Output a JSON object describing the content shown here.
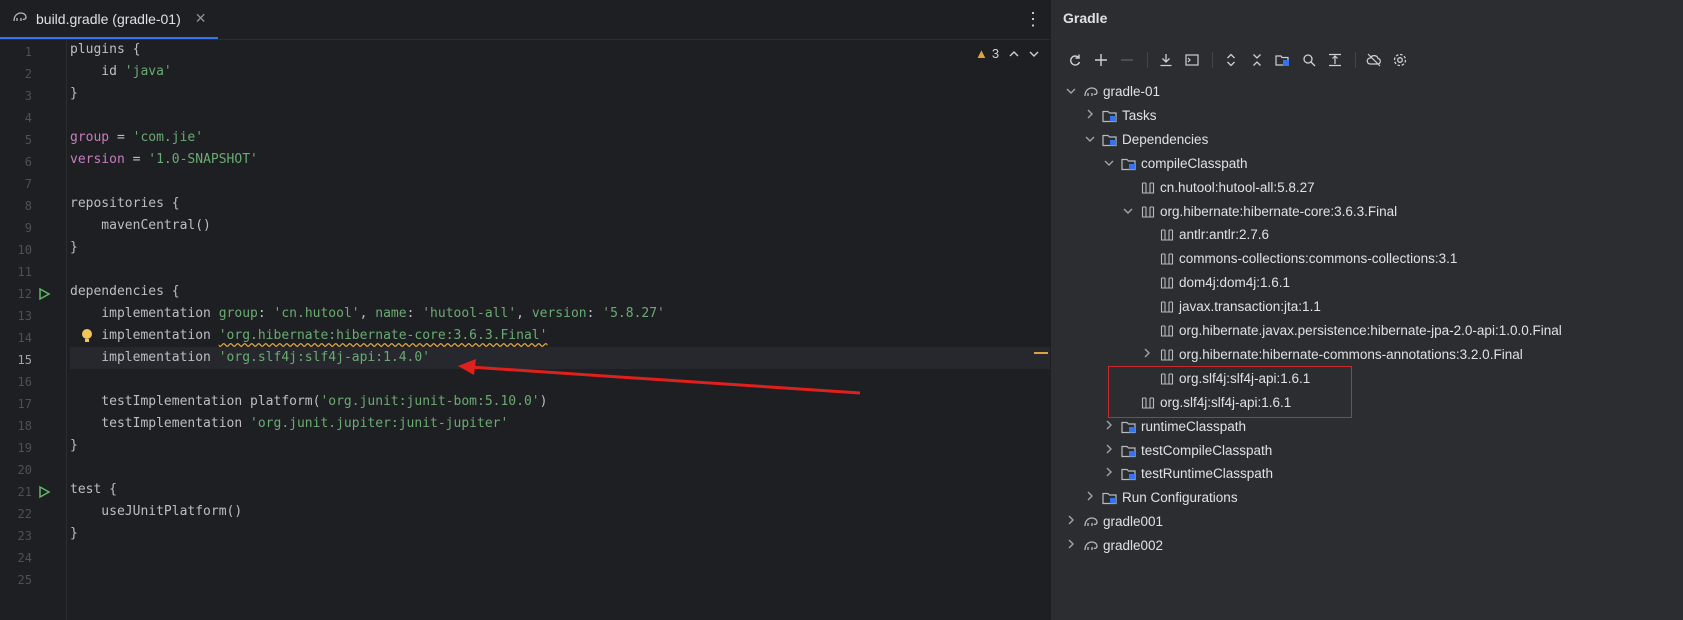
{
  "editor": {
    "tab": {
      "title": "build.gradle (gradle-01)",
      "close": "✕"
    },
    "menu_glyph": "⋮",
    "inspections": {
      "warning_count": "3",
      "up": "^",
      "down": "v"
    },
    "lines": [
      {
        "n": "1"
      },
      {
        "n": "2"
      },
      {
        "n": "3"
      },
      {
        "n": "4"
      },
      {
        "n": "5"
      },
      {
        "n": "6"
      },
      {
        "n": "7"
      },
      {
        "n": "8"
      },
      {
        "n": "9"
      },
      {
        "n": "10"
      },
      {
        "n": "11"
      },
      {
        "n": "12"
      },
      {
        "n": "13"
      },
      {
        "n": "14"
      },
      {
        "n": "15"
      },
      {
        "n": "16"
      },
      {
        "n": "17"
      },
      {
        "n": "18"
      },
      {
        "n": "19"
      },
      {
        "n": "20"
      },
      {
        "n": "21"
      },
      {
        "n": "22"
      },
      {
        "n": "23"
      },
      {
        "n": "24"
      },
      {
        "n": "25"
      }
    ],
    "code": {
      "l1": "plugins {",
      "l2a": "    id ",
      "l2b": "'java'",
      "l3": "}",
      "l5a": "group",
      "l5b": " = ",
      "l5c": "'com.jie'",
      "l6a": "version",
      "l6b": " = ",
      "l6c": "'1.0-SNAPSHOT'",
      "l8": "repositories {",
      "l9": "    mavenCentral()",
      "l10": "}",
      "l12": "dependencies {",
      "l13a": "    implementation ",
      "l13b": "group",
      "l13c": ": ",
      "l13d": "'cn.hutool'",
      "l13e": ", ",
      "l13f": "name",
      "l13g": ": ",
      "l13h": "'hutool-all'",
      "l13i": ", ",
      "l13j": "version",
      "l13k": ": ",
      "l13l": "'5.8.27'",
      "l14a": "    implementation ",
      "l14b": "'org.hibernate:hibernate-core:3.6.3.Final'",
      "l15a": "    implementation ",
      "l15b": "'org.slf4j:slf4j-api:1.4.0'",
      "l17a": "    testImplementation platform(",
      "l17b": "'org.junit:junit-bom:5.10.0'",
      "l17c": ")",
      "l18a": "    testImplementation ",
      "l18b": "'org.junit.jupiter:junit-jupiter'",
      "l19": "}",
      "l21": "test {",
      "l22": "    useJUnitPlatform()",
      "l23": "}"
    }
  },
  "gradle": {
    "title": "Gradle",
    "toolbar": [
      "refresh-icon",
      "add-icon",
      "remove-icon",
      "download-icon",
      "execute-task-icon",
      "expand-all-icon",
      "collapse-all-icon",
      "group-modules-icon",
      "analyze-icon",
      "show-deps-icon",
      "offline-icon",
      "settings-icon"
    ],
    "tree": [
      {
        "label": "gradle-01",
        "level": 0,
        "state": "open",
        "icon": "gradle-elephant-icon"
      },
      {
        "label": "Tasks",
        "level": 1,
        "state": "closed",
        "icon": "folder-icon"
      },
      {
        "label": "Dependencies",
        "level": 1,
        "state": "open",
        "icon": "folder-icon"
      },
      {
        "label": "compileClasspath",
        "level": 2,
        "state": "open",
        "icon": "folder-icon"
      },
      {
        "label": "cn.hutool:hutool-all:5.8.27",
        "level": 3,
        "state": "leaf",
        "icon": "library-icon"
      },
      {
        "label": "org.hibernate:hibernate-core:3.6.3.Final",
        "level": 3,
        "state": "open",
        "icon": "library-icon"
      },
      {
        "label": "antlr:antlr:2.7.6",
        "level": 4,
        "state": "leaf",
        "icon": "library-icon"
      },
      {
        "label": "commons-collections:commons-collections:3.1",
        "level": 4,
        "state": "leaf",
        "icon": "library-icon"
      },
      {
        "label": "dom4j:dom4j:1.6.1",
        "level": 4,
        "state": "leaf",
        "icon": "library-icon"
      },
      {
        "label": "javax.transaction:jta:1.1",
        "level": 4,
        "state": "leaf",
        "icon": "library-icon"
      },
      {
        "label": "org.hibernate.javax.persistence:hibernate-jpa-2.0-api:1.0.0.Final",
        "level": 4,
        "state": "leaf",
        "icon": "library-icon"
      },
      {
        "label": "org.hibernate:hibernate-commons-annotations:3.2.0.Final",
        "level": 4,
        "state": "closed",
        "icon": "library-icon"
      },
      {
        "label": "org.slf4j:slf4j-api:1.6.1",
        "level": 4,
        "state": "leaf",
        "icon": "library-icon"
      },
      {
        "label": "org.slf4j:slf4j-api:1.6.1",
        "level": 3,
        "state": "leaf",
        "icon": "library-icon"
      },
      {
        "label": "runtimeClasspath",
        "level": 2,
        "state": "closed",
        "icon": "folder-icon"
      },
      {
        "label": "testCompileClasspath",
        "level": 2,
        "state": "closed",
        "icon": "folder-icon"
      },
      {
        "label": "testRuntimeClasspath",
        "level": 2,
        "state": "closed",
        "icon": "folder-icon"
      },
      {
        "label": "Run Configurations",
        "level": 1,
        "state": "closed",
        "icon": "folder-icon"
      },
      {
        "label": "gradle001",
        "level": 0,
        "state": "closed",
        "icon": "gradle-elephant-icon"
      },
      {
        "label": "gradle002",
        "level": 0,
        "state": "closed",
        "icon": "gradle-elephant-icon"
      }
    ]
  },
  "annotations": {
    "highlight_color": "#cc2a2a",
    "arrow_color": "#e0201c"
  }
}
